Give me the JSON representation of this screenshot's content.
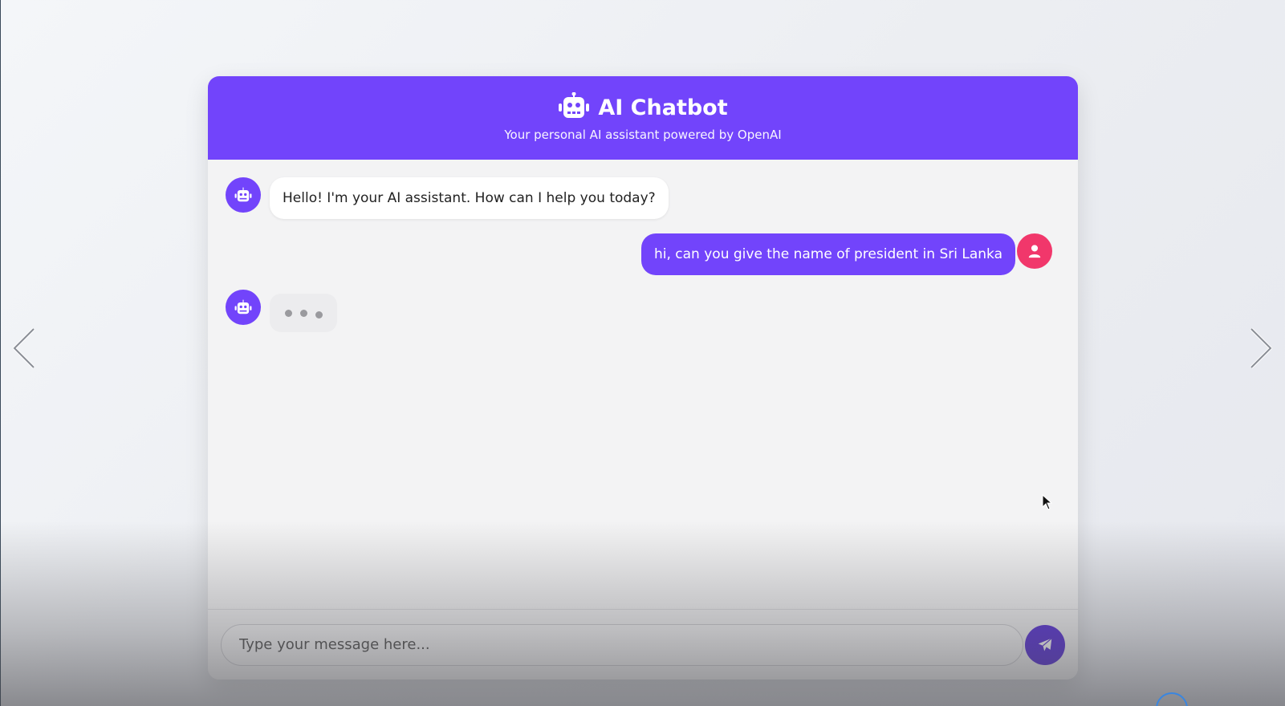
{
  "header": {
    "title": "AI Chatbot",
    "subtitle": "Your personal AI assistant powered by OpenAI",
    "icon": "robot-icon"
  },
  "messages": [
    {
      "role": "bot",
      "text": "Hello! I'm your AI assistant. How can I help you today?",
      "avatar_icon": "robot-icon"
    },
    {
      "role": "user",
      "text": "hi, can you give the name of president in Sri Lanka",
      "avatar_icon": "user-icon"
    },
    {
      "role": "bot",
      "typing": true,
      "avatar_icon": "robot-icon"
    }
  ],
  "input": {
    "placeholder": "Type your message here...",
    "value": ""
  },
  "send_button": {
    "icon": "paper-plane-icon"
  },
  "navigation": {
    "prev_icon": "chevron-left-icon",
    "next_icon": "chevron-right-icon"
  },
  "colors": {
    "primary": "#7244fb",
    "user_avatar": "#f1376b",
    "send_button": "#5a33d6",
    "card_background": "#f3f3f4"
  }
}
